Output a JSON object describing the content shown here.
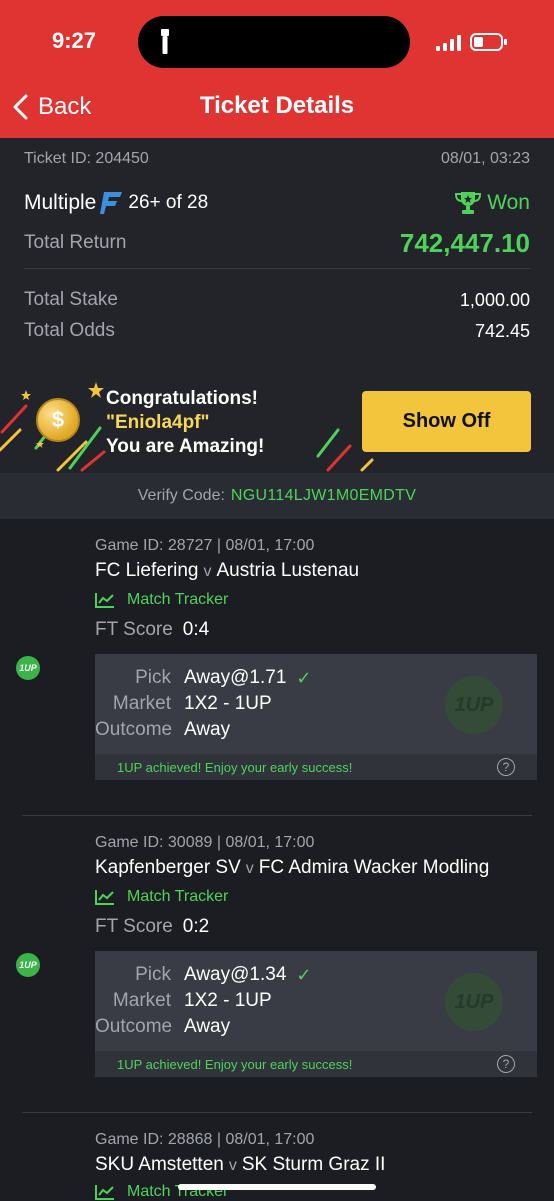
{
  "status": {
    "time": "9:27"
  },
  "nav": {
    "back_label": "Back",
    "title": "Ticket Details"
  },
  "ticket": {
    "id_text": "Ticket ID: 204450",
    "date": "08/01, 03:23",
    "type": "Multiple",
    "count": "26+ of 28",
    "status": "Won",
    "total_return_label": "Total Return",
    "total_return": "742,447.10",
    "total_stake_label": "Total Stake",
    "total_stake": "1,000.00",
    "total_odds_label": "Total Odds",
    "total_odds": "742.45"
  },
  "congrats": {
    "line1": "Congratulations!",
    "name": "\"Eniola4pf\"",
    "line3": "You are Amazing!",
    "button": "Show Off"
  },
  "verify": {
    "label": "Verify Code:",
    "code": "NGU114LJW1M0EMDTV"
  },
  "bets": [
    {
      "meta": "Game ID: 28727 | 08/01, 17:00",
      "home": "FC Liefering",
      "vs": "v",
      "away": "Austria Lustenau",
      "tracker": "Match Tracker",
      "ft_label": "FT Score",
      "ft_score": "0:4",
      "badge": "1UP",
      "pick_label": "Pick",
      "pick": "Away@1.71",
      "market_label": "Market",
      "market": "1X2 - 1UP",
      "outcome_label": "Outcome",
      "outcome": "Away",
      "watermark": "1UP",
      "achieved": "1UP achieved! Enjoy your early success!"
    },
    {
      "meta": "Game ID: 30089 | 08/01, 17:00",
      "home": "Kapfenberger SV",
      "vs": "v",
      "away": "FC Admira Wacker Modling",
      "tracker": "Match Tracker",
      "ft_label": "FT Score",
      "ft_score": "0:2",
      "badge": "1UP",
      "pick_label": "Pick",
      "pick": "Away@1.34",
      "market_label": "Market",
      "market": "1X2 - 1UP",
      "outcome_label": "Outcome",
      "outcome": "Away",
      "watermark": "1UP",
      "achieved": "1UP achieved! Enjoy your early success!"
    },
    {
      "meta": "Game ID: 28868 | 08/01, 17:00",
      "home": "SKU Amstetten",
      "vs": "v",
      "away": "SK Sturm Graz II",
      "tracker": "Match Tracker"
    }
  ],
  "colors": {
    "header": "#e03433",
    "accent_green": "#4ed35a",
    "button_yellow": "#f2c53c"
  }
}
